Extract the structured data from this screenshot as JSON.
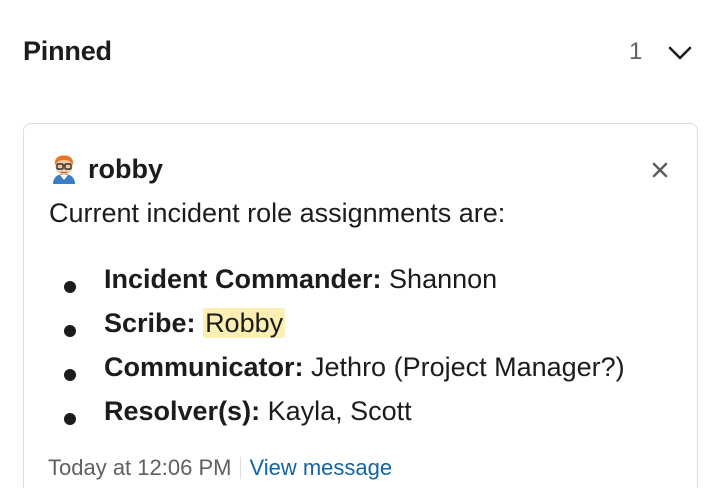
{
  "header": {
    "title": "Pinned",
    "count": "1",
    "toggle_icon": "chevron-down-icon"
  },
  "pinned_message": {
    "author": "robby",
    "avatar_icon": "avatar-emoji-icon",
    "close_icon": "close-icon",
    "text": "Current incident role assignments are:",
    "roles": [
      {
        "role": "Incident Commander:",
        "value": "Shannon",
        "mention": false
      },
      {
        "role": "Scribe:",
        "value": "Robby",
        "mention": true
      },
      {
        "role": "Communicator:",
        "value": "Jethro (Project Manager?)",
        "mention": false
      },
      {
        "role": "Resolver(s):",
        "value": "Kayla, Scott",
        "mention": false
      }
    ],
    "timestamp": "Today at 12:06 PM",
    "view_link": "View message"
  },
  "colors": {
    "text": "#1d1c1d",
    "muted": "#616061",
    "link": "#1264a3",
    "mention_bg": "#fcefb4",
    "border": "#dddddd"
  }
}
